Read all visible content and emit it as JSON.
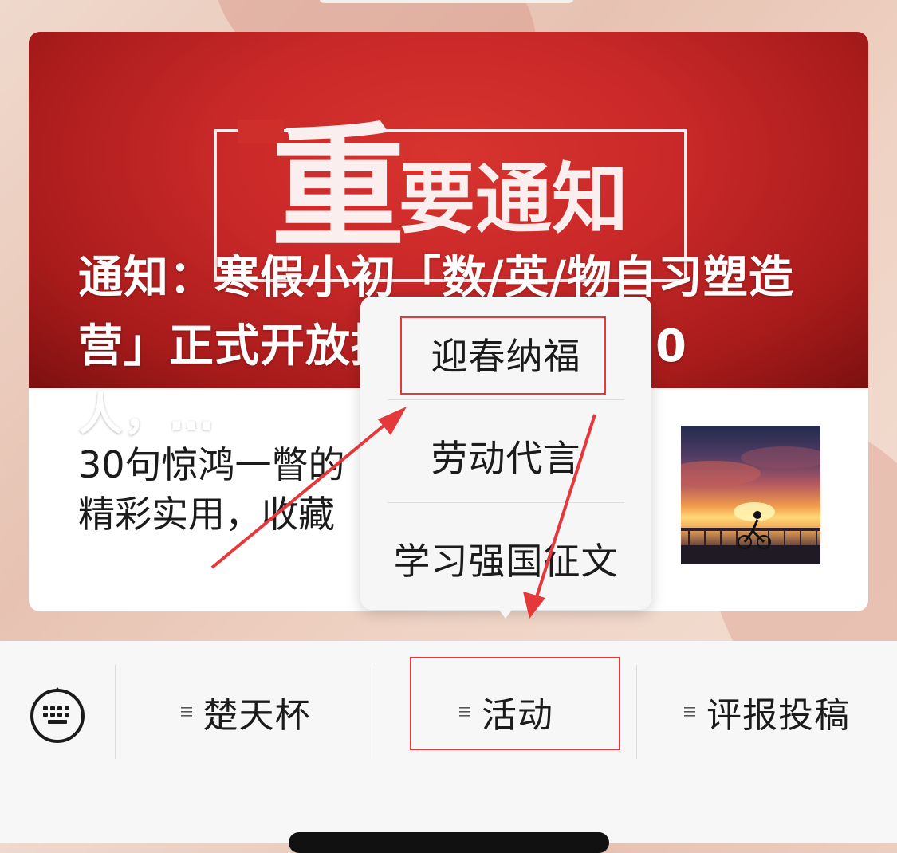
{
  "accent": {
    "brand_red": "#c82828",
    "annotation_red": "#e5383b",
    "text": "#1b1b1b"
  },
  "articles": [
    {
      "banner_text": {
        "big": "重",
        "rest": "要通知"
      },
      "headline": "通知：寒假小初「数/英/物自习塑造营」正式开放招募，每班限20人，…"
    },
    {
      "title": "30句惊鸿一瞥的\n精彩实用，收藏",
      "thumbnail": "sunset-cyclist-image"
    }
  ],
  "popup_menu": {
    "items": [
      {
        "label": "迎春纳福",
        "highlighted": true
      },
      {
        "label": "劳动代言",
        "highlighted": false
      },
      {
        "label": "学习强国征文",
        "highlighted": false
      }
    ]
  },
  "tab_bar": {
    "keyboard_icon": "keyboard-icon",
    "tabs": [
      {
        "label": "楚天杯",
        "icon": "menu-icon"
      },
      {
        "label": "活动",
        "icon": "menu-icon",
        "highlighted": true
      },
      {
        "label": "评报投稿",
        "icon": "menu-icon"
      }
    ]
  }
}
